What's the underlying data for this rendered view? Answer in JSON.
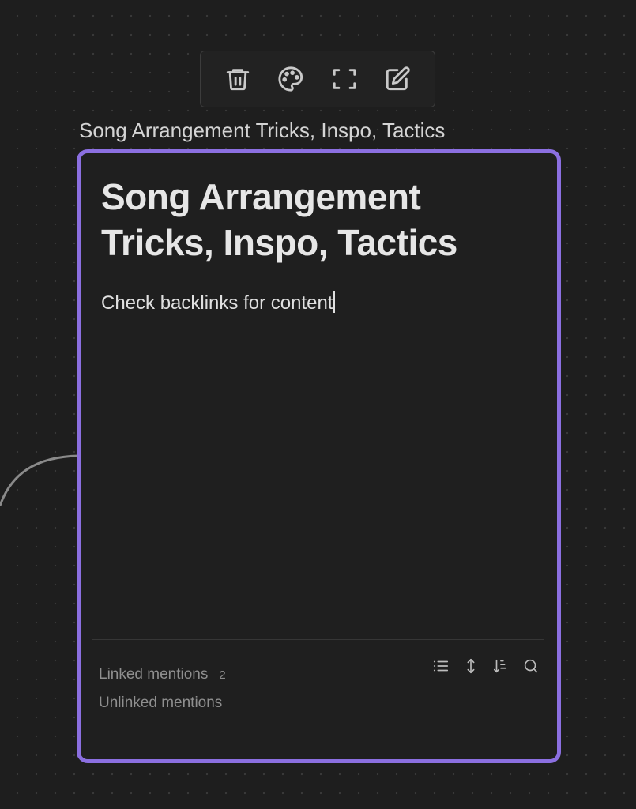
{
  "canvas": {
    "accent_color": "#8b6fe0",
    "background_color": "#1e1e1e"
  },
  "toolbar": {
    "items": [
      {
        "name": "delete",
        "icon": "trash-icon"
      },
      {
        "name": "color",
        "icon": "palette-icon"
      },
      {
        "name": "zoom-to-fit",
        "icon": "fullscreen-icon"
      },
      {
        "name": "edit",
        "icon": "edit-icon"
      }
    ]
  },
  "node": {
    "label": "Song Arrangement Tricks, Inspo, Tactics",
    "title": "Song Arrangement Tricks, Inspo, Tactics",
    "body": "Check backlinks for content"
  },
  "backlinks": {
    "linked_label": "Linked mentions",
    "linked_count": "2",
    "unlinked_label": "Unlinked mentions",
    "tools": [
      {
        "name": "collapse-results",
        "icon": "list-icon"
      },
      {
        "name": "show-more-context",
        "icon": "expand-vertical-icon"
      },
      {
        "name": "change-sort-order",
        "icon": "sort-icon"
      },
      {
        "name": "show-search-filter",
        "icon": "search-icon"
      }
    ]
  }
}
